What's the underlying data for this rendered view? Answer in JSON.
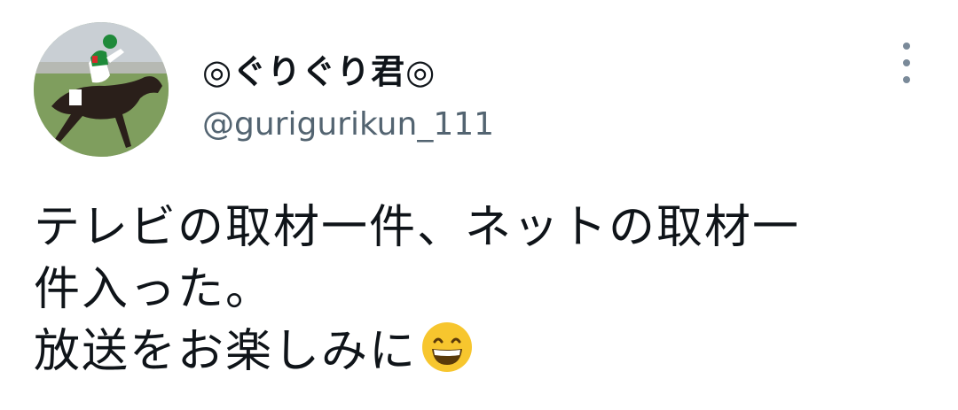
{
  "tweet": {
    "display_name": "◎ぐりぐり君◎",
    "handle": "@guriguri​kun_111",
    "text_lines": [
      "テレビの取材一件、ネットの取材一",
      "件入った。",
      "放送をお楽しみに"
    ],
    "emoji": "grinning-face-with-smiling-eyes",
    "avatar": "racehorse-jockey-photo",
    "more_icon": "vertical-ellipsis",
    "colors": {
      "text": "#0f1419",
      "secondary": "#536471",
      "icon": "#7a8a99"
    }
  }
}
